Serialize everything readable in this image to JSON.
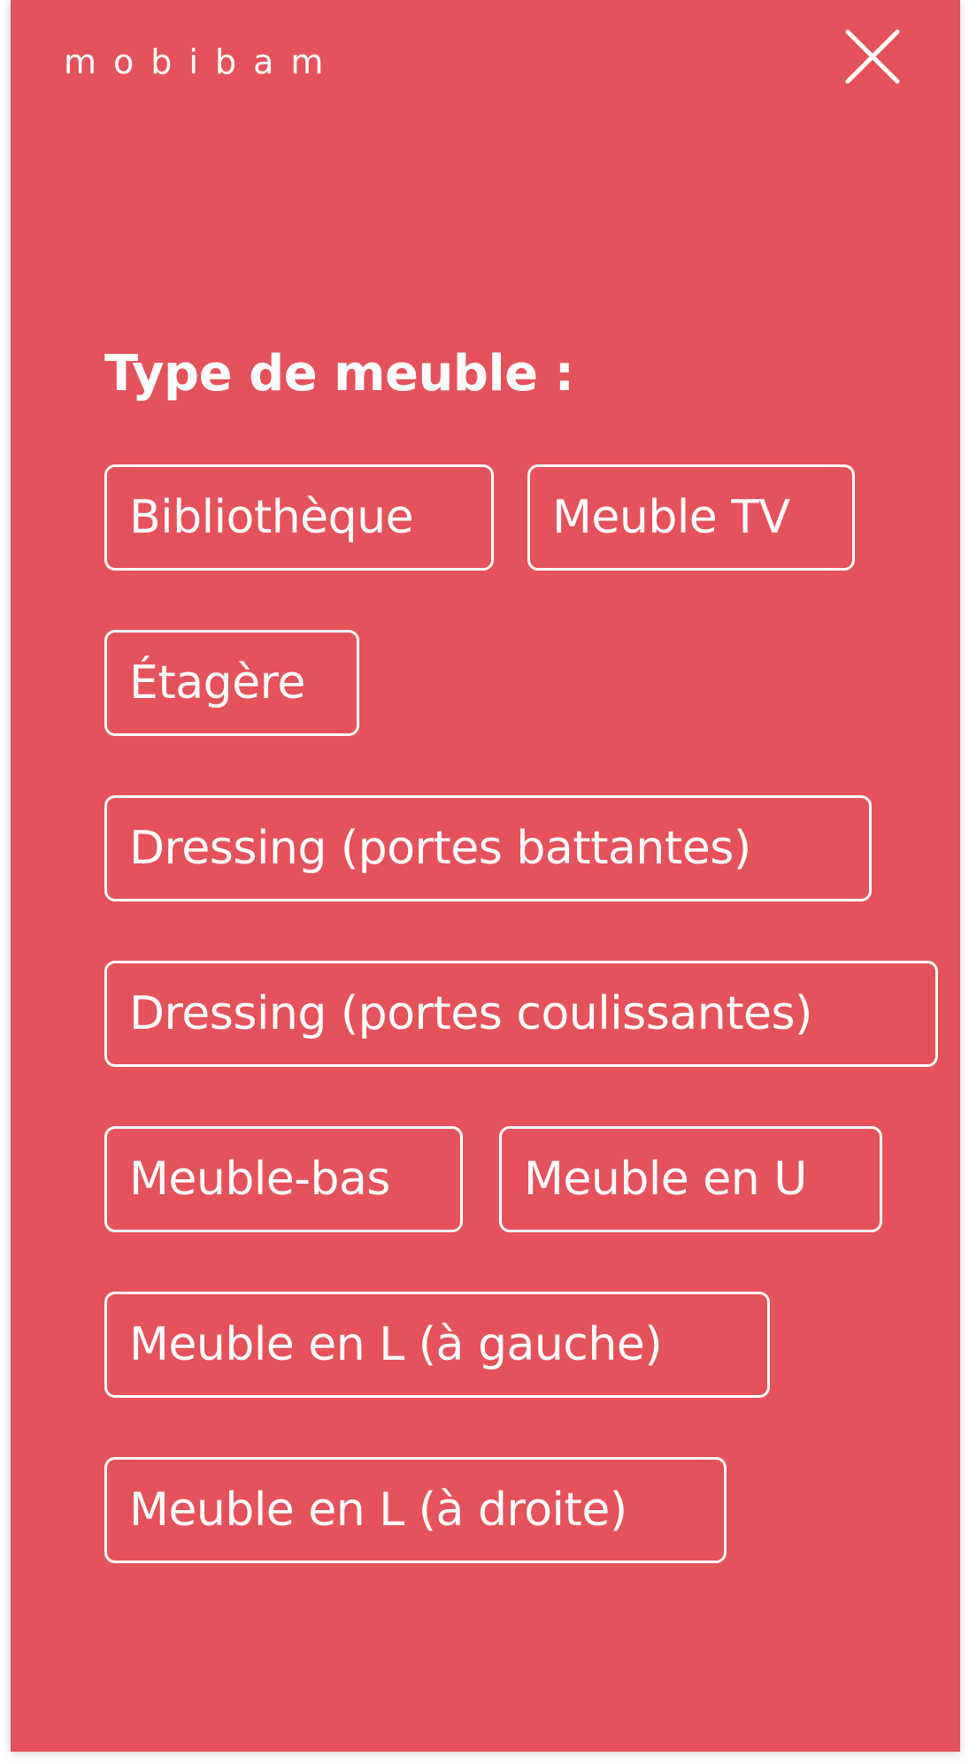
{
  "header": {
    "logo": "mobibam",
    "close_icon": "close-icon"
  },
  "filter": {
    "title": "Type de meuble :",
    "options": [
      "Bibliothèque",
      "Meuble TV",
      "Étagère",
      "Dressing (portes battantes)",
      "Dressing (portes coulissantes)",
      "Meuble-bas",
      "Meuble en U",
      "Meuble en L (à gauche)",
      "Meuble en L (à droite)"
    ]
  },
  "colors": {
    "background": "#e5525b",
    "foreground": "#ffffff"
  }
}
